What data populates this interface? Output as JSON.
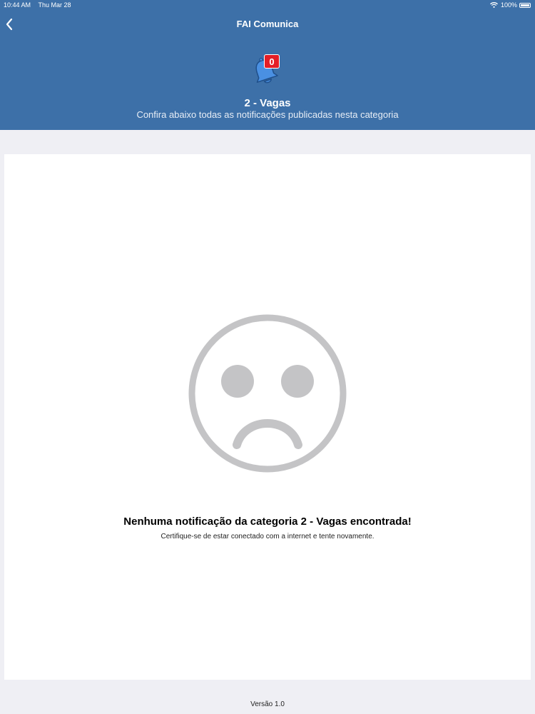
{
  "status_bar": {
    "time": "10:44 AM",
    "date": "Thu Mar 28",
    "battery": "100%"
  },
  "nav": {
    "title": "FAI Comunica"
  },
  "category": {
    "badge_count": "0",
    "title": "2 - Vagas",
    "subtitle": "Confira abaixo todas as notificações publicadas nesta categoria"
  },
  "empty_state": {
    "title": "Nenhuma notificação da categoria 2 - Vagas encontrada!",
    "message": "Certifique-se de estar conectado com a internet e tente novamente."
  },
  "footer": {
    "version": "Versão 1.0"
  },
  "colors": {
    "header": "#3d70a8",
    "badge": "#e41e26",
    "bell": "#4a90e2",
    "sad_face": "#c4c4c6"
  },
  "icons": {
    "back": "chevron-left-icon",
    "bell": "bell-icon",
    "empty": "sad-face-icon",
    "wifi": "wifi-icon",
    "battery": "battery-icon"
  }
}
